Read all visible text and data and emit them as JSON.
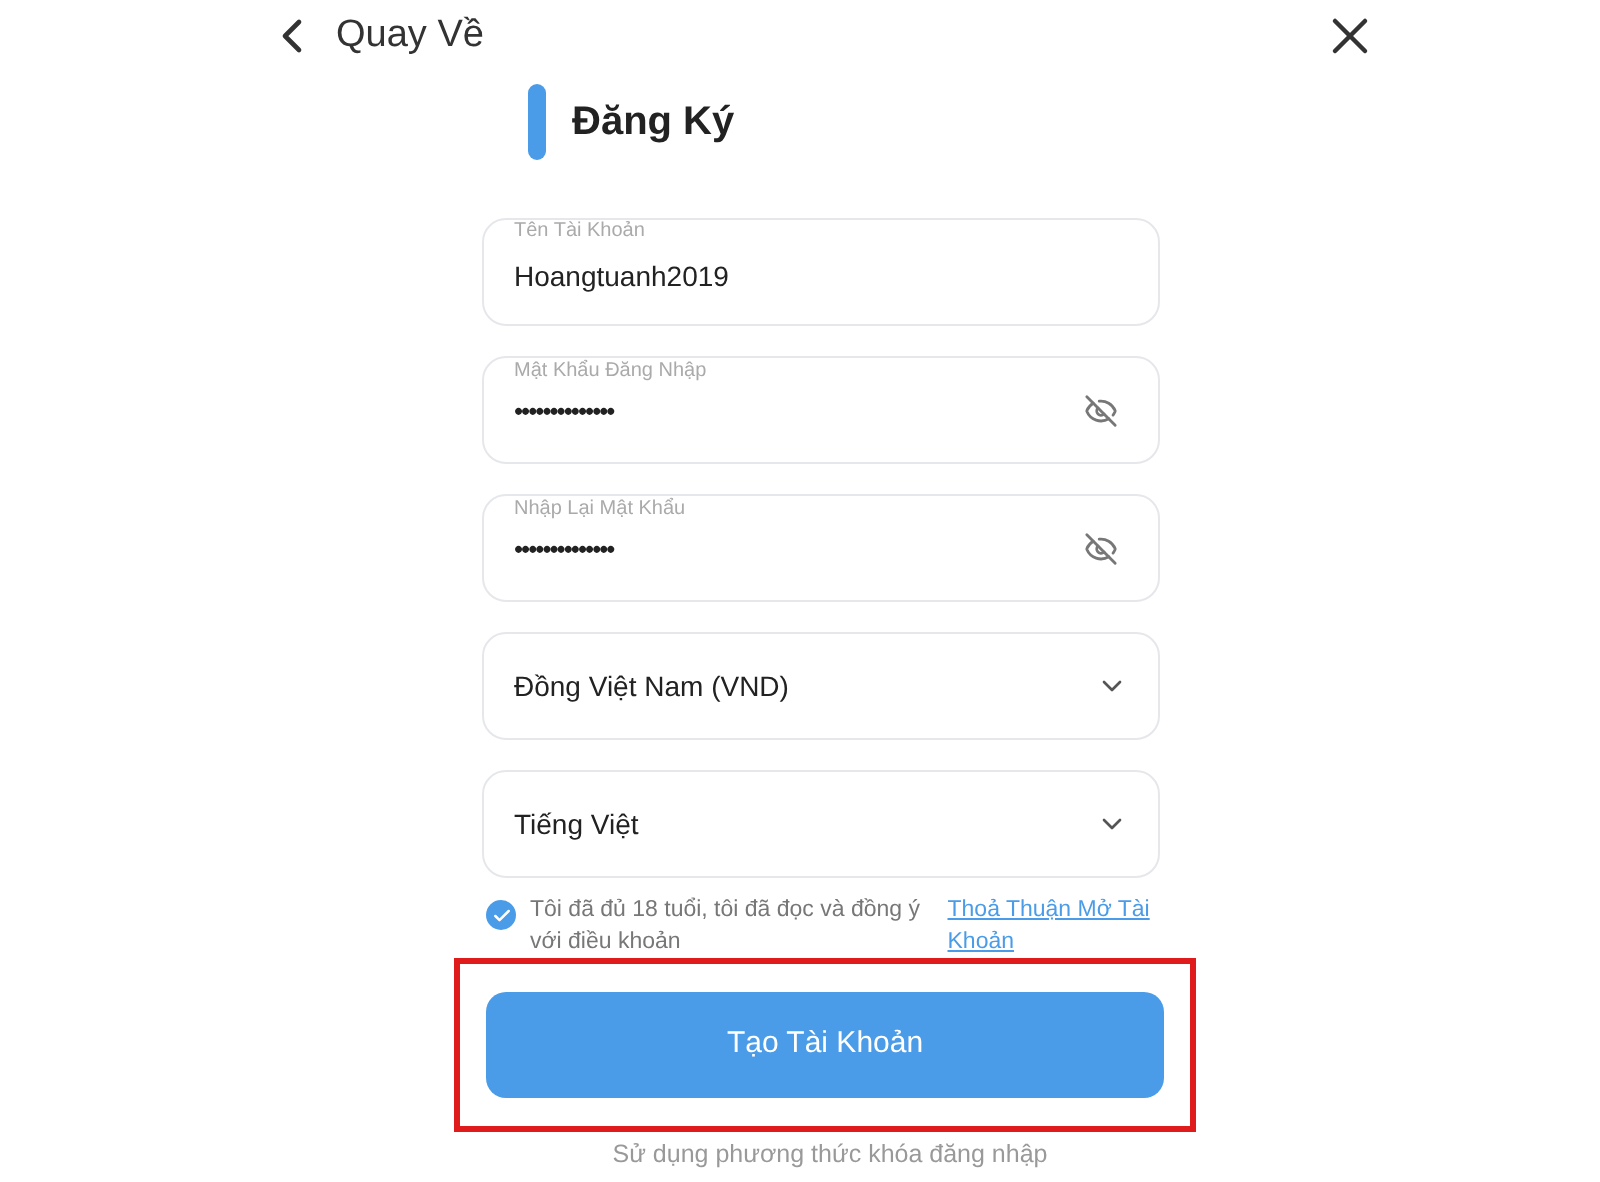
{
  "header": {
    "back_label": "Quay Về"
  },
  "title": "Đăng Ký",
  "fields": [
    {
      "kind": "text",
      "label": "Tên Tài Khoản",
      "value": "Hoangtuanh2019"
    },
    {
      "kind": "password",
      "label": "Mật Khẩu Đăng Nhập",
      "value": "••••••••••••••"
    },
    {
      "kind": "password",
      "label": "Nhập Lại Mật Khẩu",
      "value": "••••••••••••••"
    },
    {
      "kind": "select",
      "value": "Đồng Việt Nam (VND)"
    },
    {
      "kind": "select",
      "value": "Tiếng Việt"
    }
  ],
  "agreement": {
    "checked": true,
    "text": "Tôi đã đủ 18 tuổi, tôi đã đọc và đồng ý với điều khoản",
    "link": "Thoả Thuận Mở Tài Khoản"
  },
  "submit": {
    "label": "Tạo Tài Khoản",
    "highlighted": true
  },
  "footer_text": "Sử dụng phương thức khóa đăng nhập"
}
